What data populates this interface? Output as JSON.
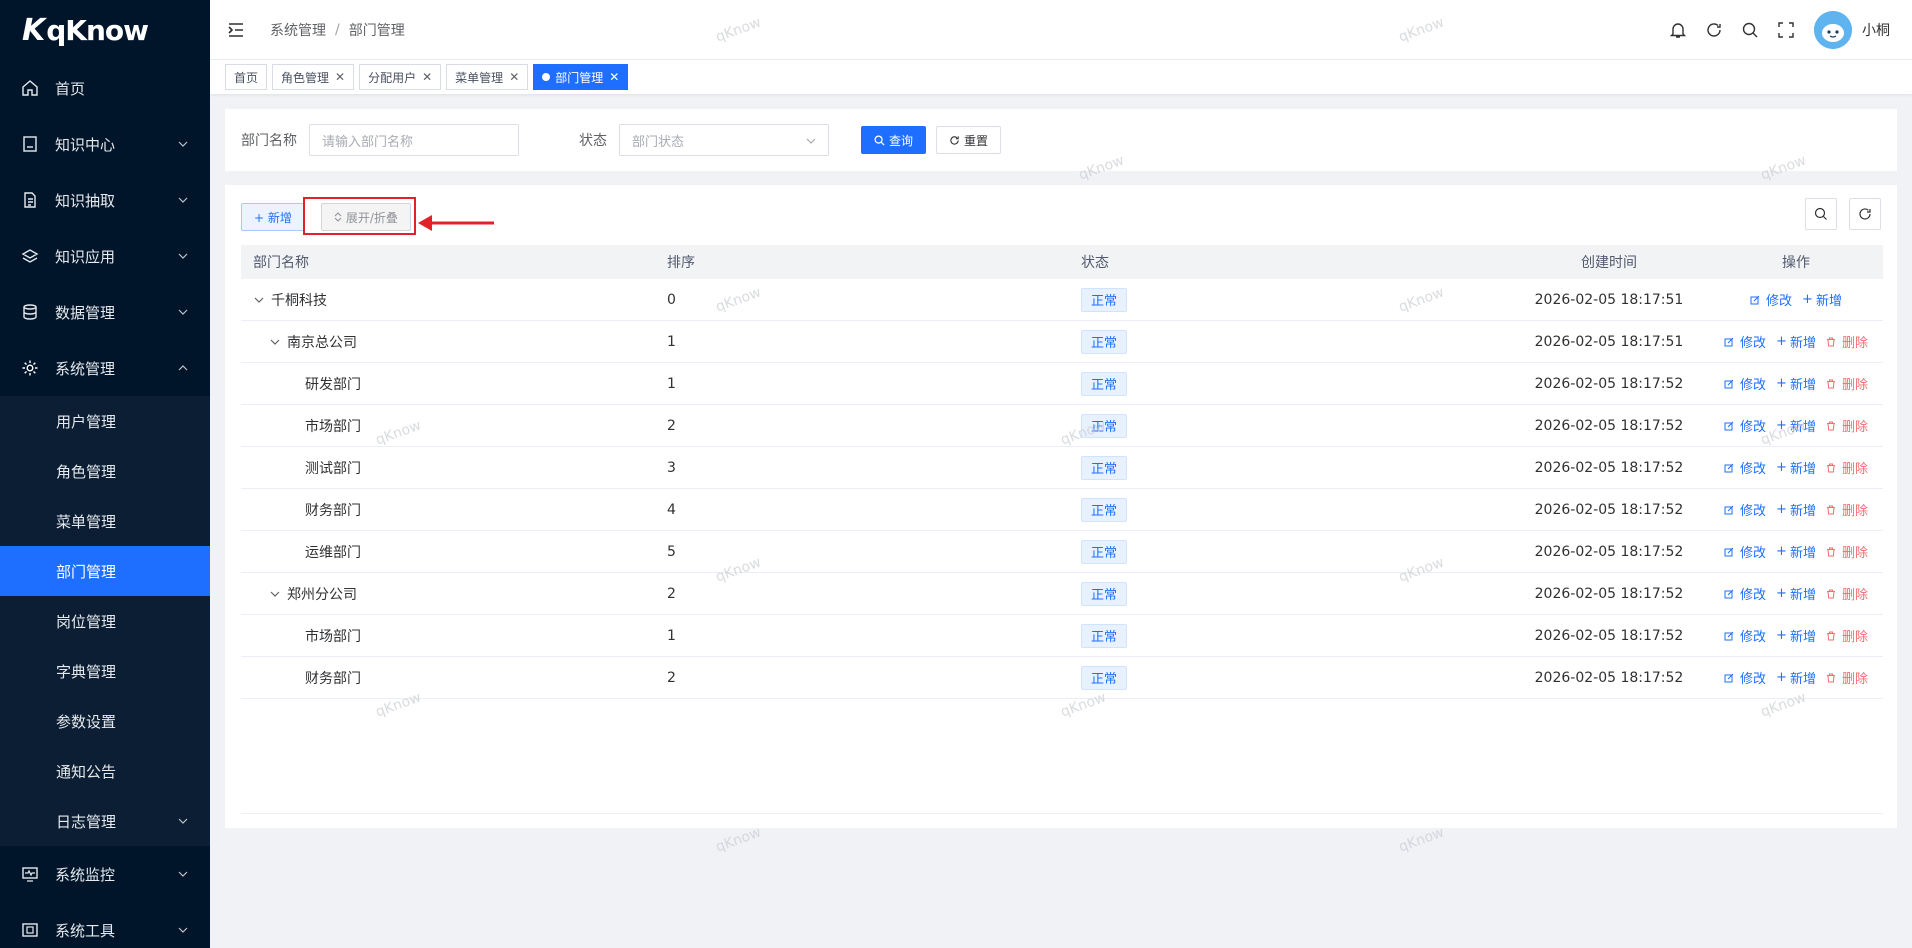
{
  "app": {
    "logo": "qKnow",
    "logo_mark": "K"
  },
  "sidebar": {
    "items": [
      {
        "label": "首页",
        "icon": "home-icon"
      },
      {
        "label": "知识中心",
        "icon": "book-icon",
        "expandable": true
      },
      {
        "label": "知识抽取",
        "icon": "document-icon",
        "expandable": true
      },
      {
        "label": "知识应用",
        "icon": "layers-icon",
        "expandable": true
      },
      {
        "label": "数据管理",
        "icon": "database-icon",
        "expandable": true
      },
      {
        "label": "系统管理",
        "icon": "gear-icon",
        "expandable": true,
        "expanded": true
      }
    ],
    "sub_items": [
      {
        "label": "用户管理"
      },
      {
        "label": "角色管理"
      },
      {
        "label": "菜单管理"
      },
      {
        "label": "部门管理",
        "active": true
      },
      {
        "label": "岗位管理"
      },
      {
        "label": "字典管理"
      },
      {
        "label": "参数设置"
      },
      {
        "label": "通知公告"
      },
      {
        "label": "日志管理",
        "expandable": true
      }
    ],
    "bottom_items": [
      {
        "label": "系统监控",
        "icon": "monitor-icon"
      },
      {
        "label": "系统工具",
        "icon": "tool-icon"
      }
    ]
  },
  "navbar": {
    "breadcrumb": [
      "系统管理",
      "部门管理"
    ],
    "breadcrumb_sep": "/",
    "username": "小桐"
  },
  "tags": [
    {
      "label": "首页",
      "closable": false
    },
    {
      "label": "角色管理",
      "closable": true
    },
    {
      "label": "分配用户",
      "closable": true
    },
    {
      "label": "菜单管理",
      "closable": true
    },
    {
      "label": "部门管理",
      "closable": true,
      "active": true
    }
  ],
  "search": {
    "name_label": "部门名称",
    "name_placeholder": "请输入部门名称",
    "status_label": "状态",
    "status_placeholder": "部门状态",
    "query_label": "查询",
    "reset_label": "重置"
  },
  "toolbar": {
    "add_label": "+ 新增",
    "toggle_label": "展开/折叠"
  },
  "table": {
    "headers": {
      "name": "部门名称",
      "order": "排序",
      "status": "状态",
      "time": "创建时间",
      "ops": "操作"
    },
    "rows": [
      {
        "name": "千桐科技",
        "order": "0",
        "status": "正常",
        "time": "2026-02-05 18:17:51",
        "level": 0,
        "caret": true,
        "delete": false
      },
      {
        "name": "南京总公司",
        "order": "1",
        "status": "正常",
        "time": "2026-02-05 18:17:51",
        "level": 1,
        "caret": true,
        "delete": true
      },
      {
        "name": "研发部门",
        "order": "1",
        "status": "正常",
        "time": "2026-02-05 18:17:52",
        "level": 2,
        "caret": false,
        "delete": true
      },
      {
        "name": "市场部门",
        "order": "2",
        "status": "正常",
        "time": "2026-02-05 18:17:52",
        "level": 2,
        "caret": false,
        "delete": true
      },
      {
        "name": "测试部门",
        "order": "3",
        "status": "正常",
        "time": "2026-02-05 18:17:52",
        "level": 2,
        "caret": false,
        "delete": true
      },
      {
        "name": "财务部门",
        "order": "4",
        "status": "正常",
        "time": "2026-02-05 18:17:52",
        "level": 2,
        "caret": false,
        "delete": true
      },
      {
        "name": "运维部门",
        "order": "5",
        "status": "正常",
        "time": "2026-02-05 18:17:52",
        "level": 2,
        "caret": false,
        "delete": true
      },
      {
        "name": "郑州分公司",
        "order": "2",
        "status": "正常",
        "time": "2026-02-05 18:17:52",
        "level": 1,
        "caret": true,
        "delete": true
      },
      {
        "name": "市场部门",
        "order": "1",
        "status": "正常",
        "time": "2026-02-05 18:17:52",
        "level": 2,
        "caret": false,
        "delete": true
      },
      {
        "name": "财务部门",
        "order": "2",
        "status": "正常",
        "time": "2026-02-05 18:17:52",
        "level": 2,
        "caret": false,
        "delete": true
      }
    ],
    "op_edit": "修改",
    "op_add": "新增",
    "op_delete": "删除"
  },
  "watermark": "qKnow",
  "colors": {
    "sidebar_bg": "#001529",
    "primary": "#1e6fff",
    "danger": "#f56c6c",
    "highlight": "#e32128"
  }
}
